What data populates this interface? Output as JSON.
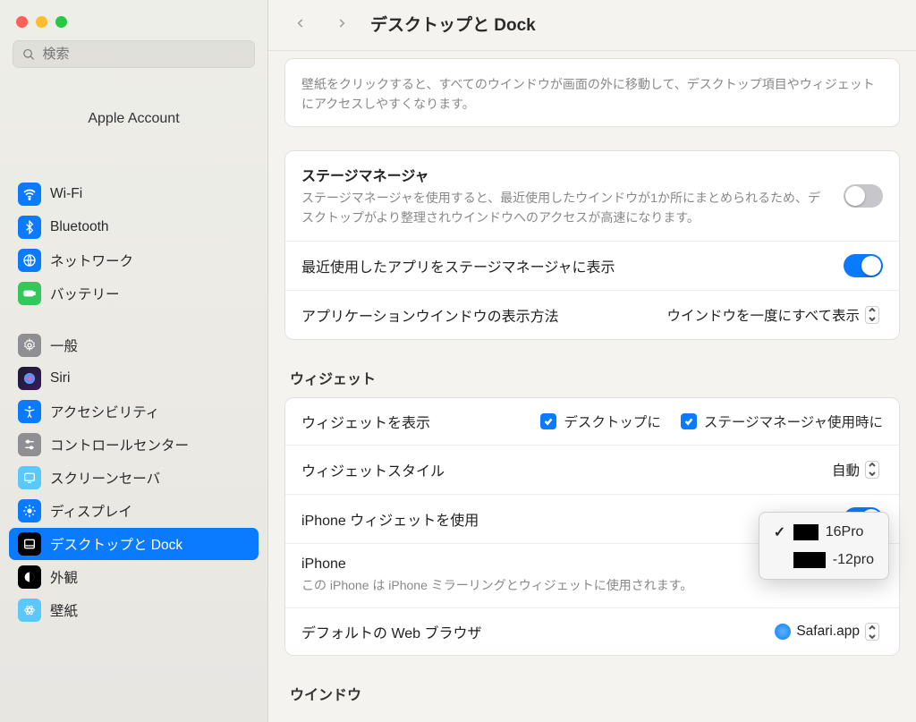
{
  "search": {
    "placeholder": "検索"
  },
  "account": {
    "label": "Apple Account"
  },
  "sidebar": {
    "items": [
      {
        "label": "Wi-Fi"
      },
      {
        "label": "Bluetooth"
      },
      {
        "label": "ネットワーク"
      },
      {
        "label": "バッテリー"
      },
      {
        "label": "一般"
      },
      {
        "label": "Siri"
      },
      {
        "label": "アクセシビリティ"
      },
      {
        "label": "コントロールセンター"
      },
      {
        "label": "スクリーンセーバ"
      },
      {
        "label": "ディスプレイ"
      },
      {
        "label": "デスクトップと Dock"
      },
      {
        "label": "外観"
      },
      {
        "label": "壁紙"
      }
    ]
  },
  "header": {
    "title": "デスクトップと Dock"
  },
  "top_card": {
    "desc": "壁紙をクリックすると、すべてのウインドウが画面の外に移動して、デスクトップ項目やウィジェットにアクセスしやすくなります。"
  },
  "stage": {
    "title": "ステージマネージャ",
    "desc": "ステージマネージャを使用すると、最近使用したウインドウが1か所にまとめられるため、デスクトップがより整理されウインドウへのアクセスが高速になります。",
    "recent_label": "最近使用したアプリをステージマネージャに表示",
    "window_method_label": "アプリケーションウインドウの表示方法",
    "window_method_value": "ウインドウを一度にすべて表示"
  },
  "widgets": {
    "heading": "ウィジェット",
    "show_label": "ウィジェットを表示",
    "check_desktop": "デスクトップに",
    "check_stage": "ステージマネージャ使用時に",
    "style_label": "ウィジェットスタイル",
    "style_value": "自動",
    "iphone_use_label": "iPhone ウィジェットを使用",
    "iphone_label": "iPhone",
    "iphone_desc": "この iPhone は iPhone ミラーリングとウィジェットに使用されます。",
    "browser_label": "デフォルトの Web ブラウザ",
    "browser_value": "Safari.app"
  },
  "dropdown": {
    "items": [
      {
        "checked": true,
        "suffix": "16Pro"
      },
      {
        "checked": false,
        "suffix": "-12pro"
      }
    ]
  },
  "window_section": {
    "heading": "ウインドウ"
  }
}
